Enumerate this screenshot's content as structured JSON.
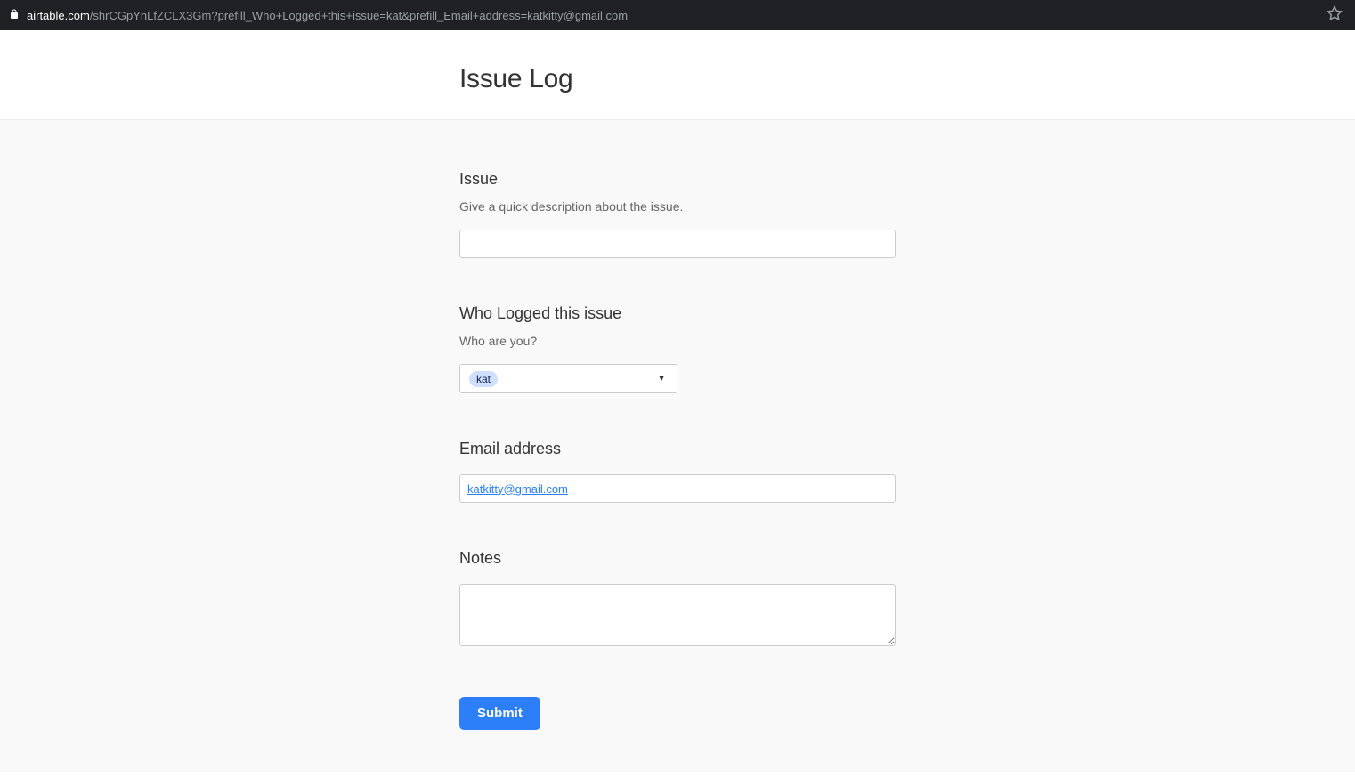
{
  "browser": {
    "url_domain": "airtable.com",
    "url_path": "/shrCGpYnLfZCLX3Gm?prefill_Who+Logged+this+issue=kat&prefill_Email+address=katkitty@gmail.com"
  },
  "header": {
    "title": "Issue Log"
  },
  "form": {
    "issue": {
      "label": "Issue",
      "description": "Give a quick description about the issue.",
      "value": ""
    },
    "who_logged": {
      "label": "Who Logged this issue",
      "description": "Who are you?",
      "selected": "kat"
    },
    "email": {
      "label": "Email address",
      "value": "katkitty@gmail.com"
    },
    "notes": {
      "label": "Notes",
      "value": ""
    },
    "submit_label": "Submit"
  }
}
